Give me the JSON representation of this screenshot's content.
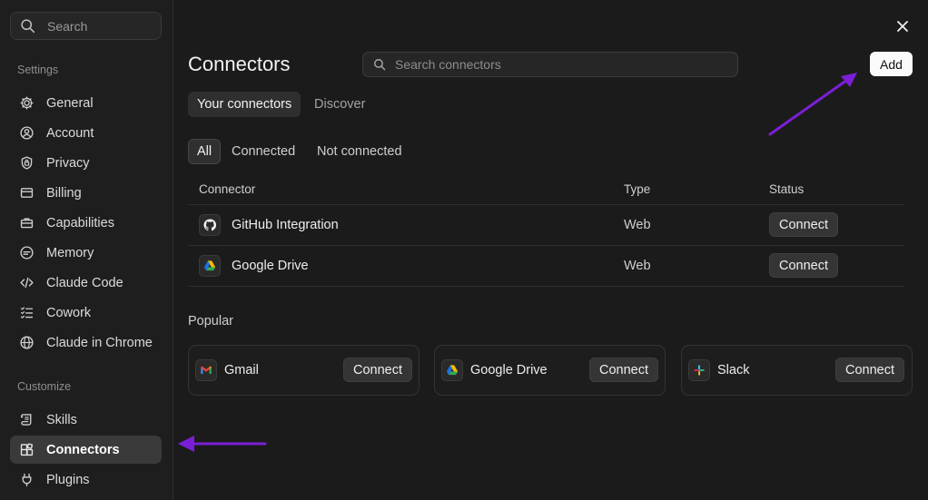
{
  "sidebar": {
    "search_placeholder": "Search",
    "settings_label": "Settings",
    "customize_label": "Customize",
    "items": [
      {
        "label": "General",
        "icon": "gear-icon"
      },
      {
        "label": "Account",
        "icon": "user-circle-icon"
      },
      {
        "label": "Privacy",
        "icon": "shield-lock-icon"
      },
      {
        "label": "Billing",
        "icon": "credit-card-icon"
      },
      {
        "label": "Capabilities",
        "icon": "briefcase-icon"
      },
      {
        "label": "Memory",
        "icon": "memory-icon"
      },
      {
        "label": "Claude Code",
        "icon": "code-icon"
      },
      {
        "label": "Cowork",
        "icon": "checklist-icon"
      },
      {
        "label": "Claude in Chrome",
        "icon": "globe-icon"
      }
    ],
    "customize_items": [
      {
        "label": "Skills",
        "icon": "scroll-icon"
      },
      {
        "label": "Connectors",
        "icon": "connectors-icon",
        "active": true
      },
      {
        "label": "Plugins",
        "icon": "plug-icon"
      }
    ]
  },
  "main": {
    "title": "Connectors",
    "search_placeholder": "Search connectors",
    "add_label": "Add",
    "tabs": [
      {
        "label": "Your connectors",
        "active": true
      },
      {
        "label": "Discover",
        "active": false
      }
    ],
    "filters": [
      {
        "label": "All",
        "active": true
      },
      {
        "label": "Connected",
        "active": false
      },
      {
        "label": "Not connected",
        "active": false
      }
    ],
    "table": {
      "headers": {
        "connector": "Connector",
        "type": "Type",
        "status": "Status"
      },
      "rows": [
        {
          "name": "GitHub Integration",
          "type": "Web",
          "action": "Connect",
          "icon": "github-icon"
        },
        {
          "name": "Google Drive",
          "type": "Web",
          "action": "Connect",
          "icon": "google-drive-icon"
        }
      ]
    },
    "popular_label": "Popular",
    "popular": [
      {
        "name": "Gmail",
        "action": "Connect",
        "icon": "gmail-icon"
      },
      {
        "name": "Google Drive",
        "action": "Connect",
        "icon": "google-drive-icon"
      },
      {
        "name": "Slack",
        "action": "Connect",
        "icon": "slack-icon"
      }
    ]
  },
  "annotations": {
    "arrow_color": "#7b1fd6"
  }
}
